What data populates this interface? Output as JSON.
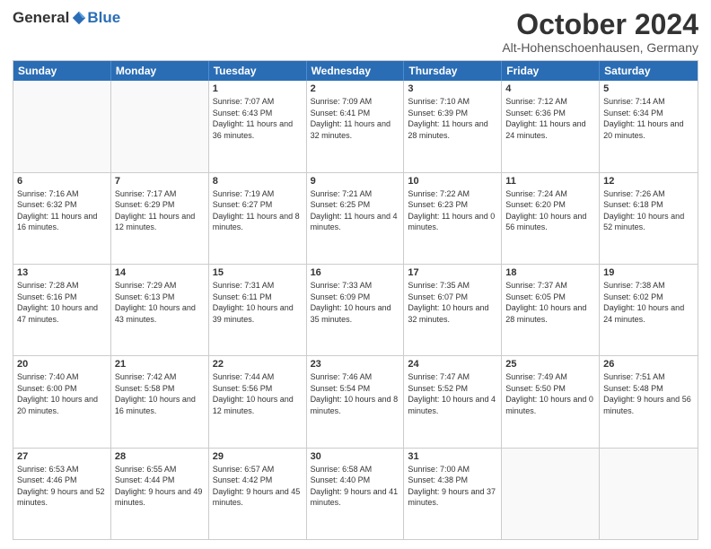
{
  "header": {
    "logo": {
      "general": "General",
      "blue": "Blue"
    },
    "title": "October 2024",
    "location": "Alt-Hohenschoenhausen, Germany"
  },
  "weekdays": [
    "Sunday",
    "Monday",
    "Tuesday",
    "Wednesday",
    "Thursday",
    "Friday",
    "Saturday"
  ],
  "weeks": [
    [
      {
        "day": "",
        "empty": true
      },
      {
        "day": "",
        "empty": true
      },
      {
        "day": "1",
        "sunrise": "Sunrise: 7:07 AM",
        "sunset": "Sunset: 6:43 PM",
        "daylight": "Daylight: 11 hours and 36 minutes."
      },
      {
        "day": "2",
        "sunrise": "Sunrise: 7:09 AM",
        "sunset": "Sunset: 6:41 PM",
        "daylight": "Daylight: 11 hours and 32 minutes."
      },
      {
        "day": "3",
        "sunrise": "Sunrise: 7:10 AM",
        "sunset": "Sunset: 6:39 PM",
        "daylight": "Daylight: 11 hours and 28 minutes."
      },
      {
        "day": "4",
        "sunrise": "Sunrise: 7:12 AM",
        "sunset": "Sunset: 6:36 PM",
        "daylight": "Daylight: 11 hours and 24 minutes."
      },
      {
        "day": "5",
        "sunrise": "Sunrise: 7:14 AM",
        "sunset": "Sunset: 6:34 PM",
        "daylight": "Daylight: 11 hours and 20 minutes."
      }
    ],
    [
      {
        "day": "6",
        "sunrise": "Sunrise: 7:16 AM",
        "sunset": "Sunset: 6:32 PM",
        "daylight": "Daylight: 11 hours and 16 minutes."
      },
      {
        "day": "7",
        "sunrise": "Sunrise: 7:17 AM",
        "sunset": "Sunset: 6:29 PM",
        "daylight": "Daylight: 11 hours and 12 minutes."
      },
      {
        "day": "8",
        "sunrise": "Sunrise: 7:19 AM",
        "sunset": "Sunset: 6:27 PM",
        "daylight": "Daylight: 11 hours and 8 minutes."
      },
      {
        "day": "9",
        "sunrise": "Sunrise: 7:21 AM",
        "sunset": "Sunset: 6:25 PM",
        "daylight": "Daylight: 11 hours and 4 minutes."
      },
      {
        "day": "10",
        "sunrise": "Sunrise: 7:22 AM",
        "sunset": "Sunset: 6:23 PM",
        "daylight": "Daylight: 11 hours and 0 minutes."
      },
      {
        "day": "11",
        "sunrise": "Sunrise: 7:24 AM",
        "sunset": "Sunset: 6:20 PM",
        "daylight": "Daylight: 10 hours and 56 minutes."
      },
      {
        "day": "12",
        "sunrise": "Sunrise: 7:26 AM",
        "sunset": "Sunset: 6:18 PM",
        "daylight": "Daylight: 10 hours and 52 minutes."
      }
    ],
    [
      {
        "day": "13",
        "sunrise": "Sunrise: 7:28 AM",
        "sunset": "Sunset: 6:16 PM",
        "daylight": "Daylight: 10 hours and 47 minutes."
      },
      {
        "day": "14",
        "sunrise": "Sunrise: 7:29 AM",
        "sunset": "Sunset: 6:13 PM",
        "daylight": "Daylight: 10 hours and 43 minutes."
      },
      {
        "day": "15",
        "sunrise": "Sunrise: 7:31 AM",
        "sunset": "Sunset: 6:11 PM",
        "daylight": "Daylight: 10 hours and 39 minutes."
      },
      {
        "day": "16",
        "sunrise": "Sunrise: 7:33 AM",
        "sunset": "Sunset: 6:09 PM",
        "daylight": "Daylight: 10 hours and 35 minutes."
      },
      {
        "day": "17",
        "sunrise": "Sunrise: 7:35 AM",
        "sunset": "Sunset: 6:07 PM",
        "daylight": "Daylight: 10 hours and 32 minutes."
      },
      {
        "day": "18",
        "sunrise": "Sunrise: 7:37 AM",
        "sunset": "Sunset: 6:05 PM",
        "daylight": "Daylight: 10 hours and 28 minutes."
      },
      {
        "day": "19",
        "sunrise": "Sunrise: 7:38 AM",
        "sunset": "Sunset: 6:02 PM",
        "daylight": "Daylight: 10 hours and 24 minutes."
      }
    ],
    [
      {
        "day": "20",
        "sunrise": "Sunrise: 7:40 AM",
        "sunset": "Sunset: 6:00 PM",
        "daylight": "Daylight: 10 hours and 20 minutes."
      },
      {
        "day": "21",
        "sunrise": "Sunrise: 7:42 AM",
        "sunset": "Sunset: 5:58 PM",
        "daylight": "Daylight: 10 hours and 16 minutes."
      },
      {
        "day": "22",
        "sunrise": "Sunrise: 7:44 AM",
        "sunset": "Sunset: 5:56 PM",
        "daylight": "Daylight: 10 hours and 12 minutes."
      },
      {
        "day": "23",
        "sunrise": "Sunrise: 7:46 AM",
        "sunset": "Sunset: 5:54 PM",
        "daylight": "Daylight: 10 hours and 8 minutes."
      },
      {
        "day": "24",
        "sunrise": "Sunrise: 7:47 AM",
        "sunset": "Sunset: 5:52 PM",
        "daylight": "Daylight: 10 hours and 4 minutes."
      },
      {
        "day": "25",
        "sunrise": "Sunrise: 7:49 AM",
        "sunset": "Sunset: 5:50 PM",
        "daylight": "Daylight: 10 hours and 0 minutes."
      },
      {
        "day": "26",
        "sunrise": "Sunrise: 7:51 AM",
        "sunset": "Sunset: 5:48 PM",
        "daylight": "Daylight: 9 hours and 56 minutes."
      }
    ],
    [
      {
        "day": "27",
        "sunrise": "Sunrise: 6:53 AM",
        "sunset": "Sunset: 4:46 PM",
        "daylight": "Daylight: 9 hours and 52 minutes."
      },
      {
        "day": "28",
        "sunrise": "Sunrise: 6:55 AM",
        "sunset": "Sunset: 4:44 PM",
        "daylight": "Daylight: 9 hours and 49 minutes."
      },
      {
        "day": "29",
        "sunrise": "Sunrise: 6:57 AM",
        "sunset": "Sunset: 4:42 PM",
        "daylight": "Daylight: 9 hours and 45 minutes."
      },
      {
        "day": "30",
        "sunrise": "Sunrise: 6:58 AM",
        "sunset": "Sunset: 4:40 PM",
        "daylight": "Daylight: 9 hours and 41 minutes."
      },
      {
        "day": "31",
        "sunrise": "Sunrise: 7:00 AM",
        "sunset": "Sunset: 4:38 PM",
        "daylight": "Daylight: 9 hours and 37 minutes."
      },
      {
        "day": "",
        "empty": true
      },
      {
        "day": "",
        "empty": true
      }
    ]
  ]
}
